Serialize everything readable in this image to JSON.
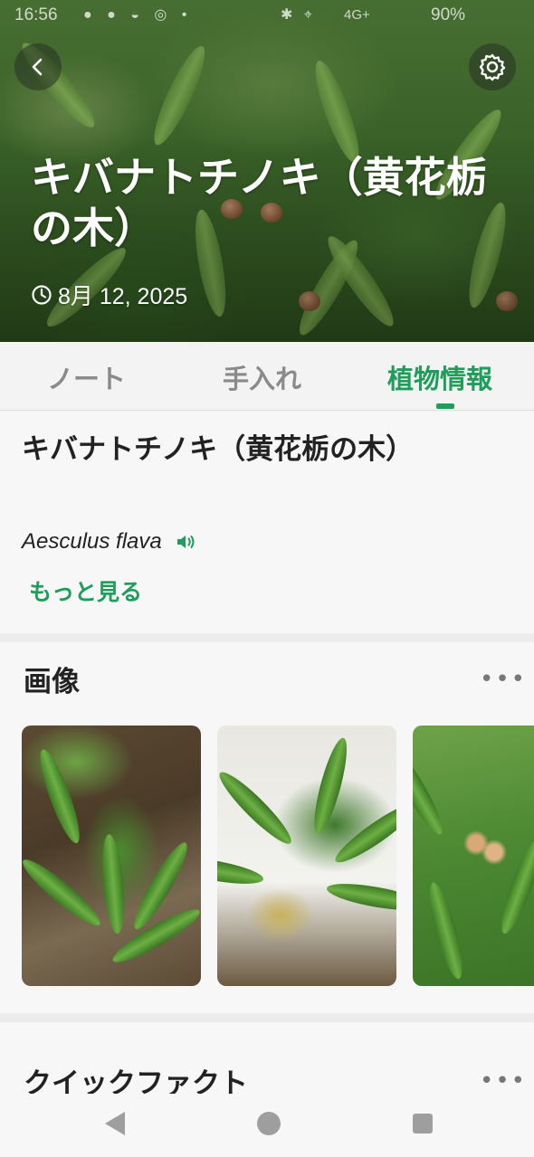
{
  "status_bar": {
    "time": "16:56",
    "network": "4G+",
    "battery": "90%"
  },
  "hero": {
    "title": "キバナトチノキ（黄花栃の木）",
    "date": "8月 12, 2025"
  },
  "tabs": [
    {
      "label": "ノート",
      "active": false
    },
    {
      "label": "手入れ",
      "active": false
    },
    {
      "label": "植物情報",
      "active": true
    }
  ],
  "plant": {
    "common_name": "キバナトチノキ（黄花栃の木）",
    "scientific_name": "Aesculus flava",
    "more_link": "もっと見る"
  },
  "images_section": {
    "title": "画像",
    "more": "•••"
  },
  "quick_facts": {
    "title": "クイックファクト",
    "more": "•••"
  },
  "colors": {
    "accent": "#1e9e5a",
    "tab_inactive": "#8a8a8a"
  },
  "icons": [
    "back-icon",
    "settings-gear-icon",
    "clock-icon",
    "speaker-icon",
    "more-icon",
    "nav-back-icon",
    "nav-home-icon",
    "nav-recents-icon"
  ]
}
